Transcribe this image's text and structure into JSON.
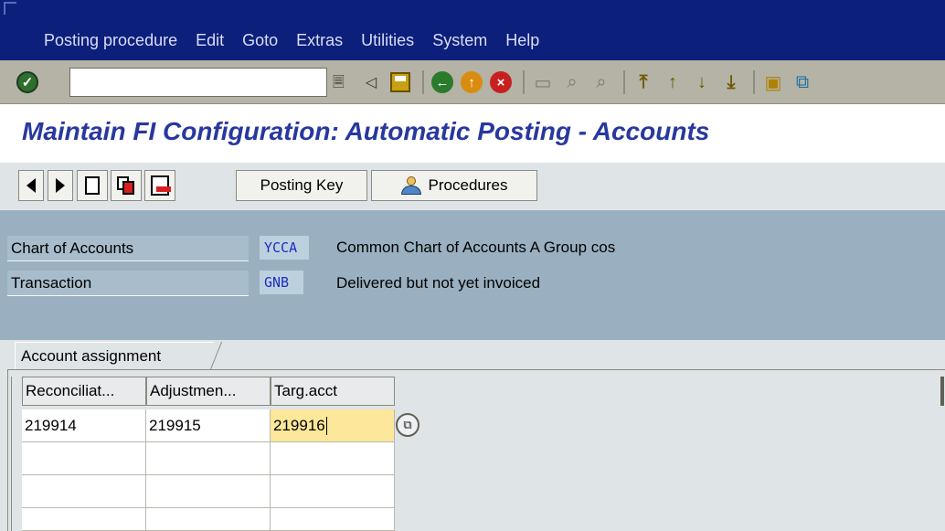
{
  "menubar": {
    "items": [
      "Posting procedure",
      "Edit",
      "Goto",
      "Extras",
      "Utilities",
      "System",
      "Help"
    ]
  },
  "toolbar": {
    "command_field_value": "",
    "icons": [
      "enter-icon",
      "command-dropdown-icon",
      "back-small-icon",
      "save-icon",
      "back-icon",
      "exit-icon",
      "cancel-icon",
      "print-icon",
      "find-icon",
      "find-next-icon",
      "first-page-icon",
      "previous-page-icon",
      "next-page-icon",
      "last-page-icon",
      "create-session-icon",
      "shortcut-icon"
    ]
  },
  "title": "Maintain FI Configuration: Automatic Posting - Accounts",
  "app_toolbar": {
    "posting_key_label": "Posting Key",
    "procedures_label": "Procedures"
  },
  "header": {
    "chart_of_accounts_label": "Chart of Accounts",
    "chart_of_accounts_value": "YCCA",
    "chart_of_accounts_desc": "Common Chart of Accounts A Group cos",
    "transaction_label": "Transaction",
    "transaction_value": "GNB",
    "transaction_desc": "Delivered but not yet invoiced"
  },
  "tab": {
    "label": "Account assignment"
  },
  "table": {
    "columns": [
      "Reconciliat...",
      "Adjustmen...",
      "Targ.acct"
    ],
    "rows": [
      [
        "219914",
        "219915",
        "219916"
      ]
    ]
  },
  "colors": {
    "menubar_bg": "#0c1f7a",
    "title_color": "#28389e",
    "header_bg": "#9ab0c0",
    "active_cell": "#fde79a"
  }
}
